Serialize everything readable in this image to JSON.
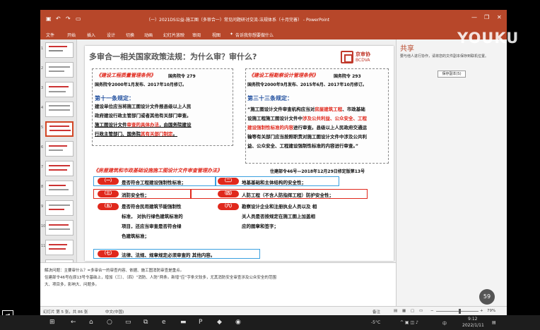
{
  "window": {
    "title": "（一）2021DS公益-施工图（多审合一）常见问题研讨交流-法规体系（十月完善） - PowerPoint",
    "controls": [
      "—",
      "❐",
      "✕"
    ]
  },
  "menu": [
    "文件",
    "开始",
    "插入",
    "设计",
    "切换",
    "动画",
    "幻灯片放映",
    "审阅",
    "视图"
  ],
  "tell_me": "告诉我你想要做什么",
  "thumbnails": [
    "1",
    "2",
    "3",
    "4",
    "5",
    "6",
    "7",
    "8",
    "9",
    "10",
    "11",
    "12",
    "13"
  ],
  "slide": {
    "title": "多审合一相关国家政策法规：为什么审？审什么?",
    "logo_cn": "京审协",
    "logo_en": "BCDVA",
    "left": {
      "law": "《建设工程质量管理条例》",
      "decree": "国务院令 279",
      "dates": "国务院令2000年1月发布、2017年10月修订。",
      "clause": "第十一条规定：",
      "lines": [
        {
          "a": "建设单位应当将施工图设计文件报县级以上人民",
          "b": "",
          "c": ""
        },
        {
          "a": "政府建设行政主管部门或者其他有关部门审查。",
          "b": "",
          "c": ""
        },
        {
          "a": "施工图设计文件",
          "b": "审查的具体办法",
          "c": "，由国务院建设"
        },
        {
          "a": "行政主管部门、国务院",
          "b": "其有关部门制定",
          "c": "。"
        }
      ]
    },
    "right": {
      "law": "《建设工程勘察设计管理条例》",
      "decree": "国务院令 293",
      "dates": "国务院令2000年9月发布、2015年6月、2017年10月修订。",
      "clause": "第三十三条规定：",
      "lines": [
        {
          "a": "“施工图设计文件审查机构应当对",
          "b": "房屋建筑工程",
          "c": "、市政基础"
        },
        {
          "a": "设施工程施工图设计文件中",
          "b": "涉及公共利益、公众安全、工程",
          "c": ""
        },
        {
          "a": "",
          "b": "建设强制性标准的内容",
          "c": "进行审查。县级以上人民政府交通运"
        },
        {
          "a": "输等有关部门应当按照职责对施工图设计文件中涉及公共利",
          "b": "",
          "c": ""
        },
        {
          "a": "益、公众安全、工程建设强制性标准的内容进行审查。”",
          "b": "",
          "c": ""
        }
      ]
    },
    "bottom_law": "《房屋建筑和市政基础设施施工图设计文件审查管理办法》",
    "bottom_decree": "住建部令46号—2018年12月29日修定版第13号",
    "items": [
      {
        "num": "（一）",
        "text": "是否符合工程建设强制性标准；"
      },
      {
        "num": "（二）",
        "text": "地基基础和主体结构的安全性；"
      },
      {
        "num": "（三）",
        "text": "消防安全性；"
      },
      {
        "num": "（四）",
        "text": "人防工程（不含人防指挥工程）防护安全性；"
      },
      {
        "num": "（五）",
        "text": [
          "是否符合民用建筑节能强制性",
          "标准，  对执行绿色建筑标准的",
          "项目，还应当审查是否符合绿",
          "色建筑标准；"
        ]
      },
      {
        "num": "（六）",
        "text": [
          "勘察设计企业和注册执业人员以及 相",
          "关人员是否按规定在施工图上加盖相",
          "应的图章和签字；"
        ]
      },
      {
        "num": "（七）",
        "text": "法律、法规、规章规定必须审查的 其他内容。"
      }
    ],
    "page_number": "5"
  },
  "notes": [
    "解决问题：主要审什么？=多审合一的审查内容、依据、施工图消防审查是重点。",
    "住建部令46号在原13号令基础上，增加（三）、（四）“消防、人防”两条。新增“应”字条文较多，尤其消防安全审查涉及公众安全的范围",
    "大、项目多，影响大、问题多。"
  ],
  "pane": {
    "title": "共享",
    "text": "要与他人进行协作，请将您的文件副本保存到联机位置。",
    "button": "保存副本(S)"
  },
  "status": {
    "slide": "幻灯片 第 5 张，共 86 张",
    "lang": "中文(中国)",
    "zoom": "79%",
    "notes_btn": "备注"
  },
  "taskbar": {
    "weather": "-5°C",
    "time": "9:12",
    "date": "2022/1/11",
    "ime": "中"
  },
  "watermark": "YOUKU",
  "badge": "59"
}
